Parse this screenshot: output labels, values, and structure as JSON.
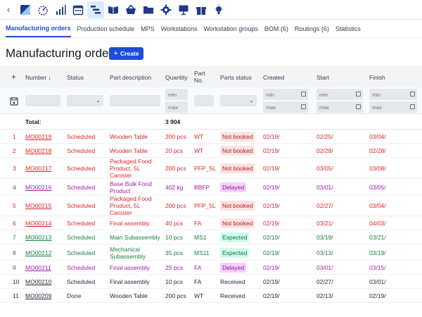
{
  "toolbar": {
    "back_icon": "chevron-left-icon",
    "icons": [
      "dashboard-icon",
      "gauge-icon",
      "bar-chart-icon",
      "calendar-icon",
      "gantt-icon",
      "book-icon",
      "basket-icon",
      "folder-icon",
      "gear-icon",
      "presentation-icon",
      "gift-icon",
      "lightbulb-icon"
    ]
  },
  "subnav": {
    "items": [
      "Manufacturing orders",
      "Production schedule",
      "MPS",
      "Workstations",
      "Workstation groups",
      "BOM (6)",
      "Routings (6)",
      "Statistics"
    ]
  },
  "header": {
    "title": "Manufacturing orders",
    "create_label": "Create"
  },
  "table": {
    "columns": {
      "add": "+",
      "number": "Number ↓",
      "status": "Status",
      "part_description": "Part description",
      "quantity": "Quantity",
      "part_no": "Part No.",
      "parts_status": "Parts status",
      "created": "Created",
      "start": "Start",
      "finish": "Finish"
    },
    "filters": {
      "min": "min",
      "max": "max"
    },
    "total_label": "Total:",
    "total_quantity": "3 904",
    "rows": [
      {
        "idx": "1",
        "number": "MO00219",
        "status": "Scheduled",
        "desc": "Wooden Table",
        "qty": "200 pcs",
        "part_no": "WT",
        "parts_status": "Not booked",
        "created": "02/19/",
        "start": "02/25/",
        "finish": "03/04/",
        "tone": "red",
        "badge": "red"
      },
      {
        "idx": "2",
        "number": "MO00218",
        "status": "Scheduled",
        "desc": "Wooden Table",
        "qty": "20 pcs",
        "part_no": "WT",
        "parts_status": "Not booked",
        "created": "02/19/",
        "start": "02/28/",
        "finish": "02/28/",
        "tone": "red",
        "badge": "red"
      },
      {
        "idx": "3",
        "number": "MO00217",
        "status": "Scheduled",
        "desc": "Packaged Food Product, 5L Canister",
        "qty": "200 pcs",
        "part_no": "PFP_5L",
        "parts_status": "Not booked",
        "created": "02/19/",
        "start": "03/05/",
        "finish": "03/08/",
        "tone": "red",
        "badge": "red"
      },
      {
        "idx": "4",
        "number": "MO00216",
        "status": "Scheduled",
        "desc": "Base Bulk Food Product",
        "qty": "402 kg",
        "part_no": "BBFP",
        "parts_status": "Delayed",
        "created": "02/19/",
        "start": "03/01/",
        "finish": "03/05/",
        "tone": "purple",
        "badge": "purple"
      },
      {
        "idx": "5",
        "number": "MO00215",
        "status": "Scheduled",
        "desc": "Packaged Food Product, 5L Canister",
        "qty": "200 pcs",
        "part_no": "PFP_5L",
        "parts_status": "Not booked",
        "created": "02/19/",
        "start": "02/27/",
        "finish": "03/04/",
        "tone": "red",
        "badge": "red"
      },
      {
        "idx": "6",
        "number": "MO00214",
        "status": "Scheduled",
        "desc": "Final assembly",
        "qty": "40 pcs",
        "part_no": "FA",
        "parts_status": "Not booked",
        "created": "02/19/",
        "start": "03/21/",
        "finish": "04/03/",
        "tone": "red",
        "badge": "red"
      },
      {
        "idx": "7",
        "number": "MO00213",
        "status": "Scheduled",
        "desc": "Main Subassembly",
        "qty": "10 pcs",
        "part_no": "MS1",
        "parts_status": "Expected",
        "created": "02/19/",
        "start": "03/19/",
        "finish": "03/21/",
        "tone": "green",
        "badge": "green"
      },
      {
        "idx": "8",
        "number": "MO00212",
        "status": "Scheduled",
        "desc": "Mechanical Subassembly",
        "qty": "35 pcs",
        "part_no": "MS11",
        "parts_status": "Expected",
        "created": "02/19/",
        "start": "03/13/",
        "finish": "03/19/",
        "tone": "green",
        "badge": "green"
      },
      {
        "idx": "9",
        "number": "MO00211",
        "status": "Scheduled",
        "desc": "Final assembly",
        "qty": "25 pcs",
        "part_no": "FA",
        "parts_status": "Delayed",
        "created": "02/19/",
        "start": "03/01/",
        "finish": "03/15/",
        "tone": "purple",
        "badge": "purple"
      },
      {
        "idx": "10",
        "number": "MO00210",
        "status": "Scheduled",
        "desc": "Final assembly",
        "qty": "10 pcs",
        "part_no": "FA",
        "parts_status": "Received",
        "created": "02/19/",
        "start": "02/27/",
        "finish": "03/01/",
        "tone": "dark",
        "badge": "none"
      },
      {
        "idx": "11",
        "number": "MO00209",
        "status": "Done",
        "desc": "Wooden Table",
        "qty": "200 pcs",
        "part_no": "WT",
        "parts_status": "Received",
        "created": "02/19/",
        "start": "02/13/",
        "finish": "02/19/",
        "tone": "dark",
        "badge": "none"
      }
    ]
  }
}
